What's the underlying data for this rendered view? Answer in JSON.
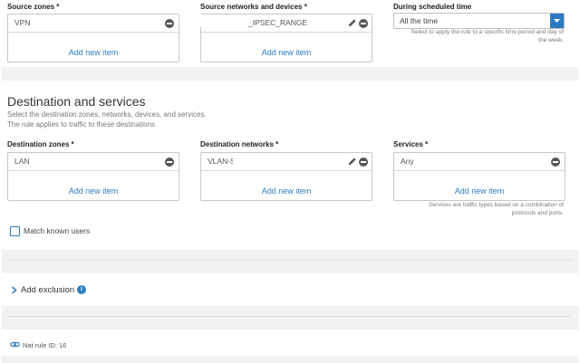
{
  "source": {
    "zones_label": "Source zones *",
    "zones_value": "VPN",
    "networks_label": "Source networks and devices *",
    "networks_value": "_IPSEC_RANGE",
    "schedule_label": "During scheduled time",
    "schedule_value": "All the time",
    "schedule_help": "Select to apply the rule to a specific time period and day of the week."
  },
  "destination": {
    "title": "Destination and services",
    "desc1": "Select the destination zones, networks, devices, and services.",
    "desc2": "The rule applies to traffic to these destinations.",
    "zones_label": "Destination zones *",
    "zones_value": "LAN",
    "networks_label": "Destination networks *",
    "networks_value": "VLAN-S",
    "services_label": "Services *",
    "services_value": "Any",
    "services_help": "Services are traffic types based on a combination of protocols and ports."
  },
  "common": {
    "add_new_item": "Add new item"
  },
  "match_known_users": {
    "label": "Match known users",
    "checked": false
  },
  "exclusion": {
    "label": "Add exclusion"
  },
  "footer": {
    "nat_rule_id": "Nat rule ID: 16"
  },
  "colors": {
    "link": "#2e7ec0",
    "dropdown": "#2c7bc2",
    "panel_gray": "#f2f2f2"
  }
}
